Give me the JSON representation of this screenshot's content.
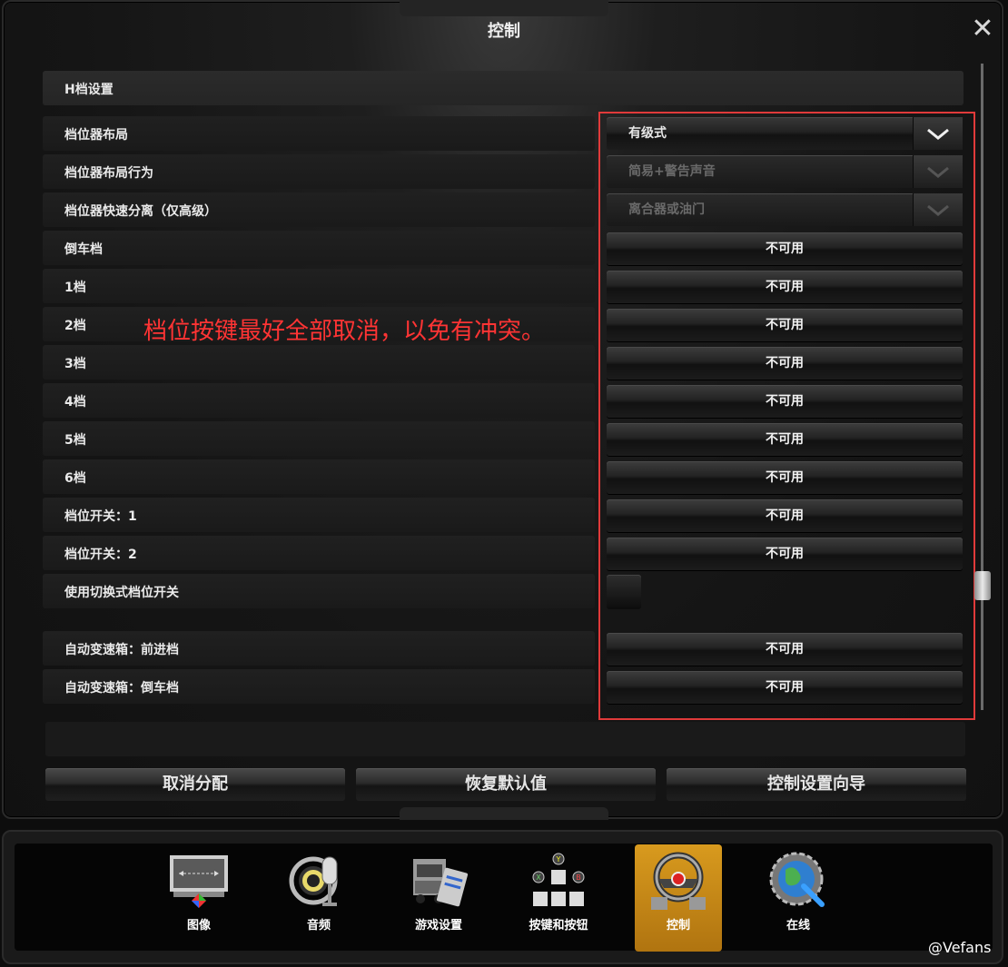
{
  "window": {
    "title": "控制",
    "close_glyph": "✕"
  },
  "section_header": "H档设置",
  "rows": [
    {
      "label": "档位器布局",
      "control": "select",
      "value": "有级式",
      "enabled": true
    },
    {
      "label": "档位器布局行为",
      "control": "select",
      "value": "简易+警告声音",
      "enabled": false
    },
    {
      "label": "档位器快速分离（仅高级）",
      "control": "select",
      "value": "离合器或油门",
      "enabled": false
    },
    {
      "label": "倒车档",
      "control": "button",
      "value": "不可用"
    },
    {
      "label": "1档",
      "control": "button",
      "value": "不可用"
    },
    {
      "label": "2档",
      "control": "button",
      "value": "不可用"
    },
    {
      "label": "3档",
      "control": "button",
      "value": "不可用"
    },
    {
      "label": "4档",
      "control": "button",
      "value": "不可用"
    },
    {
      "label": "5档",
      "control": "button",
      "value": "不可用"
    },
    {
      "label": "6档",
      "control": "button",
      "value": "不可用"
    },
    {
      "label": "档位开关：1",
      "control": "button",
      "value": "不可用"
    },
    {
      "label": "档位开关：2",
      "control": "button",
      "value": "不可用"
    },
    {
      "label": "使用切换式档位开关",
      "control": "checkbox",
      "checked": false
    },
    {
      "label": "自动变速箱：前进档",
      "control": "button",
      "value": "不可用"
    },
    {
      "label": "自动变速箱：倒车档",
      "control": "button",
      "value": "不可用"
    }
  ],
  "annotation": "档位按键最好全部取消，以免有冲突。",
  "actions": {
    "unbind": "取消分配",
    "restore_defaults": "恢复默认值",
    "setup_wizard": "控制设置向导"
  },
  "nav": [
    {
      "label": "图像",
      "icon": "monitor-icon",
      "active": false
    },
    {
      "label": "音频",
      "icon": "microphone-icon",
      "active": false
    },
    {
      "label": "游戏设置",
      "icon": "truck-clipboard-icon",
      "active": false
    },
    {
      "label": "按键和按钮",
      "icon": "keyboard-gamepad-icon",
      "active": false
    },
    {
      "label": "控制",
      "icon": "steering-wheel-icon",
      "active": true
    },
    {
      "label": "在线",
      "icon": "globe-gear-icon",
      "active": false
    }
  ],
  "watermark": "@Vefans",
  "colors": {
    "annotation": "#ff3434",
    "highlight_box": "#e03a3a",
    "active_nav": "#d89a1e"
  }
}
